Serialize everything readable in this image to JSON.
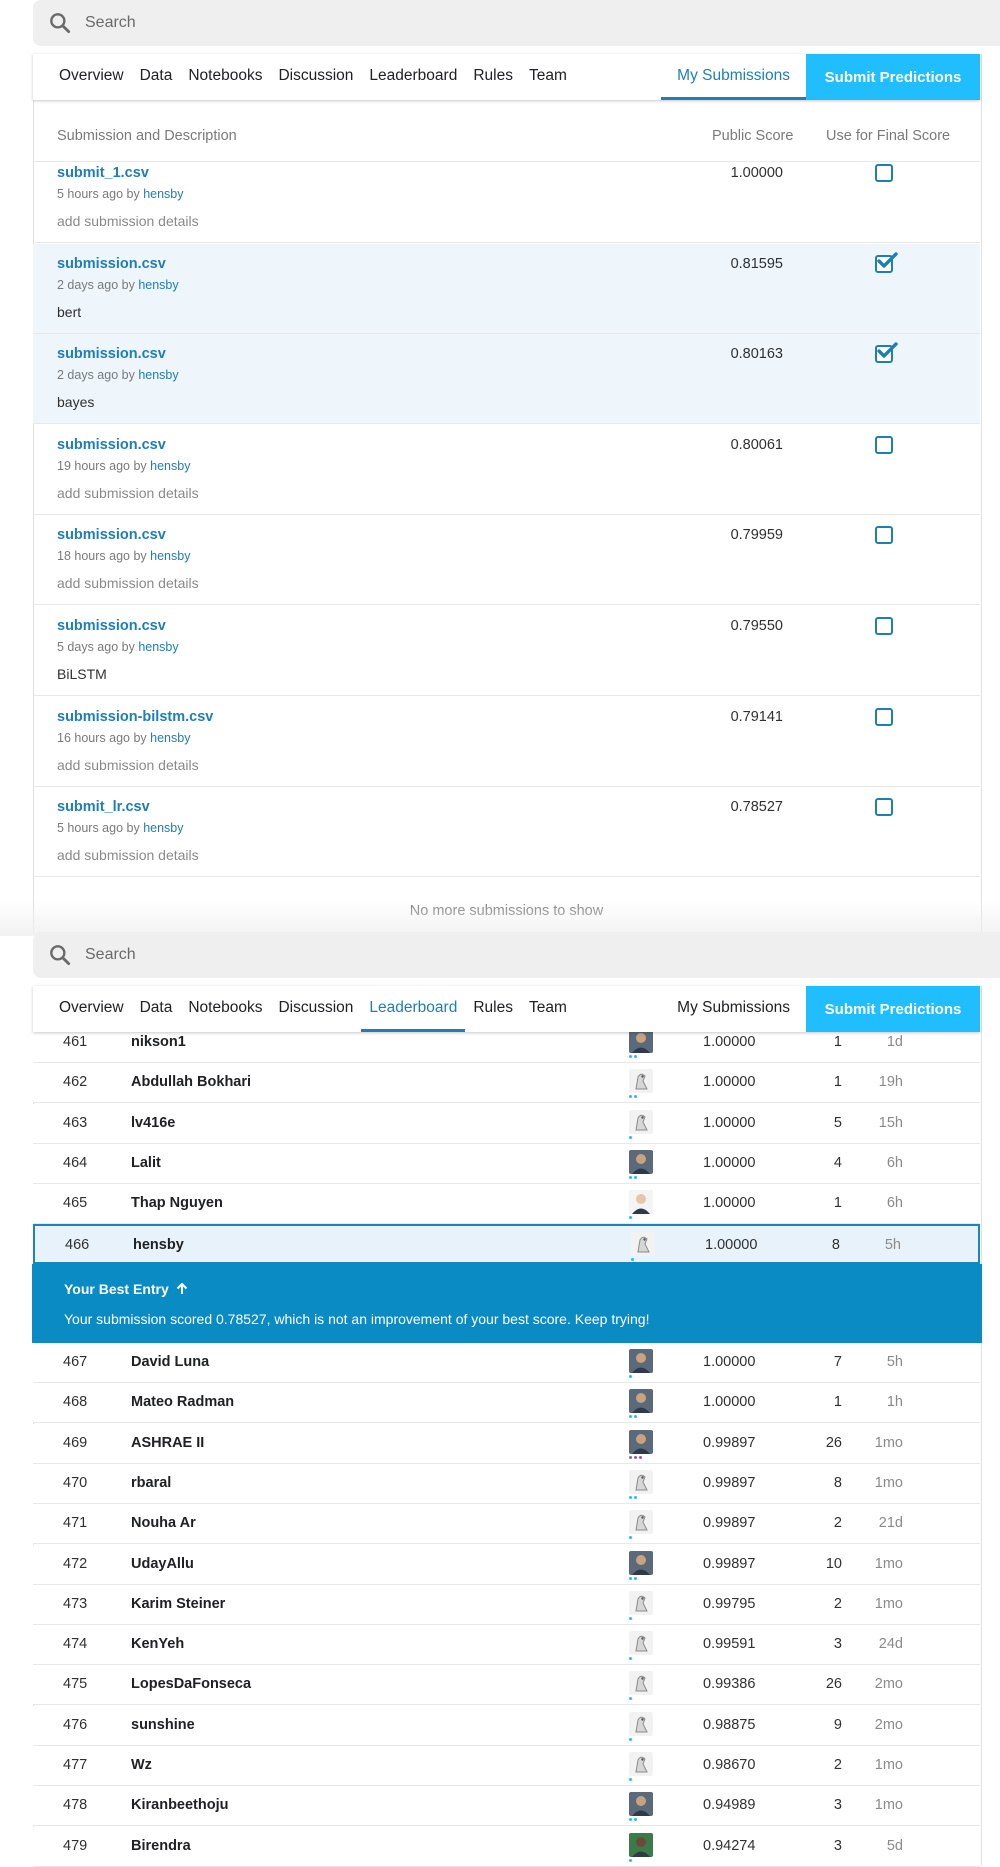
{
  "search": {
    "placeholder": "Search"
  },
  "tabs": [
    {
      "label": "Overview"
    },
    {
      "label": "Data"
    },
    {
      "label": "Notebooks"
    },
    {
      "label": "Discussion"
    },
    {
      "label": "Leaderboard"
    },
    {
      "label": "Rules"
    },
    {
      "label": "Team"
    }
  ],
  "my_submissions": "My Submissions",
  "submit_predictions": "Submit Predictions",
  "submissions": {
    "header": {
      "description": "Submission and Description",
      "public_score": "Public Score",
      "final_score": "Use for Final Score"
    },
    "rows": [
      {
        "file": "submit_1.csv",
        "time": "5 hours ago by",
        "user": "hensby",
        "description": "add submission details",
        "score": "1.00000",
        "checked": false
      },
      {
        "file": "submission.csv",
        "time": "2 days ago by",
        "user": "hensby",
        "description": "bert",
        "score": "0.81595",
        "checked": true
      },
      {
        "file": "submission.csv",
        "time": "2 days ago by",
        "user": "hensby",
        "description": "bayes",
        "score": "0.80163",
        "checked": true
      },
      {
        "file": "submission.csv",
        "time": "19 hours ago by",
        "user": "hensby",
        "description": "add submission details",
        "score": "0.80061",
        "checked": false
      },
      {
        "file": "submission.csv",
        "time": "18 hours ago by",
        "user": "hensby",
        "description": "add submission details",
        "score": "0.79959",
        "checked": false
      },
      {
        "file": "submission.csv",
        "time": "5 days ago by",
        "user": "hensby",
        "description": "BiLSTM",
        "score": "0.79550",
        "checked": false
      },
      {
        "file": "submission-bilstm.csv",
        "time": "16 hours ago by",
        "user": "hensby",
        "description": "add submission details",
        "score": "0.79141",
        "checked": false
      },
      {
        "file": "submit_lr.csv",
        "time": "5 hours ago by",
        "user": "hensby",
        "description": "add submission details",
        "score": "0.78527",
        "checked": false
      }
    ],
    "no_more": "No more submissions to show"
  },
  "leaderboard": {
    "rows_before": [
      {
        "rank": "461",
        "name": "nikson1",
        "score": "1.00000",
        "entries": "1",
        "last": "1d",
        "avatar": "photo",
        "tier": "blue"
      },
      {
        "rank": "462",
        "name": "Abdullah Bokhari",
        "score": "1.00000",
        "entries": "1",
        "last": "19h",
        "avatar": "default",
        "tier": "blue"
      },
      {
        "rank": "463",
        "name": "lv416e",
        "score": "1.00000",
        "entries": "5",
        "last": "15h",
        "avatar": "default",
        "tier": "teal"
      },
      {
        "rank": "464",
        "name": "Lalit",
        "score": "1.00000",
        "entries": "4",
        "last": "6h",
        "avatar": "photo",
        "tier": "blue"
      },
      {
        "rank": "465",
        "name": "Thap Nguyen",
        "score": "1.00000",
        "entries": "1",
        "last": "6h",
        "avatar": "photo-light",
        "tier": "teal"
      }
    ],
    "me": {
      "rank": "466",
      "name": "hensby",
      "score": "1.00000",
      "entries": "8",
      "last": "5h",
      "avatar": "default",
      "tier": "teal"
    },
    "best_entry_title": "Your Best Entry",
    "best_entry_message": "Your submission scored 0.78527, which is not an improvement of your best score. Keep trying!",
    "rows_after": [
      {
        "rank": "467",
        "name": "David Luna",
        "score": "1.00000",
        "entries": "7",
        "last": "5h",
        "avatar": "photo",
        "tier": "teal"
      },
      {
        "rank": "468",
        "name": "Mateo Radman",
        "score": "1.00000",
        "entries": "1",
        "last": "1h",
        "avatar": "photo",
        "tier": "blue"
      },
      {
        "rank": "469",
        "name": "ASHRAE II",
        "score": "0.99897",
        "entries": "26",
        "last": "1mo",
        "avatar": "photo",
        "tier": "purple"
      },
      {
        "rank": "470",
        "name": "rbaral",
        "score": "0.99897",
        "entries": "8",
        "last": "1mo",
        "avatar": "default",
        "tier": "blue"
      },
      {
        "rank": "471",
        "name": "Nouha Ar",
        "score": "0.99897",
        "entries": "2",
        "last": "21d",
        "avatar": "default",
        "tier": "teal"
      },
      {
        "rank": "472",
        "name": "UdayAllu",
        "score": "0.99897",
        "entries": "10",
        "last": "1mo",
        "avatar": "photo",
        "tier": "blue"
      },
      {
        "rank": "473",
        "name": "Karim Steiner",
        "score": "0.99795",
        "entries": "2",
        "last": "1mo",
        "avatar": "default",
        "tier": "teal"
      },
      {
        "rank": "474",
        "name": "KenYeh",
        "score": "0.99591",
        "entries": "3",
        "last": "24d",
        "avatar": "default",
        "tier": "teal"
      },
      {
        "rank": "475",
        "name": "LopesDaFonseca",
        "score": "0.99386",
        "entries": "26",
        "last": "2mo",
        "avatar": "default",
        "tier": "teal"
      },
      {
        "rank": "476",
        "name": "sunshine",
        "score": "0.98875",
        "entries": "9",
        "last": "2mo",
        "avatar": "default",
        "tier": "teal"
      },
      {
        "rank": "477",
        "name": "Wz",
        "score": "0.98670",
        "entries": "2",
        "last": "1mo",
        "avatar": "default",
        "tier": "teal"
      },
      {
        "rank": "478",
        "name": "Kiranbeethoju",
        "score": "0.94989",
        "entries": "3",
        "last": "1mo",
        "avatar": "photo",
        "tier": "blue"
      },
      {
        "rank": "479",
        "name": "Birendra",
        "score": "0.94274",
        "entries": "3",
        "last": "5d",
        "avatar": "photo-green",
        "tier": "teal"
      }
    ]
  },
  "colors": {
    "accent": "#1f7fb4",
    "submit_button": "#20beff",
    "best_banner": "#0b8bc4",
    "selected_row": "#eef5fb"
  },
  "icons": {
    "search": "search-icon",
    "checkbox": "checkbox-icon",
    "arrow": "arrow-up-icon"
  }
}
